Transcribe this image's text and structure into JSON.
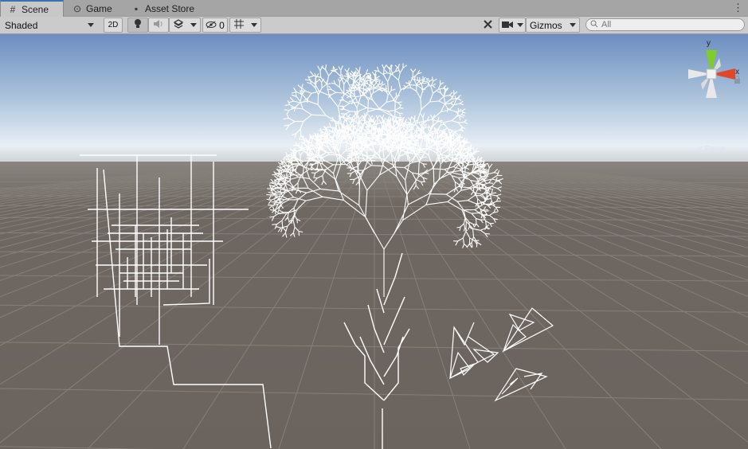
{
  "tabs": [
    {
      "label": "Scene",
      "icon": "grid-icon",
      "active": true
    },
    {
      "label": "Game",
      "icon": "gamepad-icon",
      "active": false
    },
    {
      "label": "Asset Store",
      "icon": "bag-icon",
      "active": false
    }
  ],
  "toolbar": {
    "draw_mode": "Shaded",
    "mode_2d": "2D",
    "hidden_count": "0",
    "gizmos": "Gizmos",
    "search_placeholder": "All"
  },
  "gizmo": {
    "y_label": "y",
    "x_label": "x",
    "projection": "Persp",
    "colors": {
      "x": "#e0482c",
      "y": "#7fcc2a",
      "z": "#4a7bd1"
    }
  },
  "colors": {
    "sky_top": "#6d8fc0",
    "horizon": "#e8eef4",
    "ground": "#6d6560",
    "accent": "#3a72b0"
  }
}
